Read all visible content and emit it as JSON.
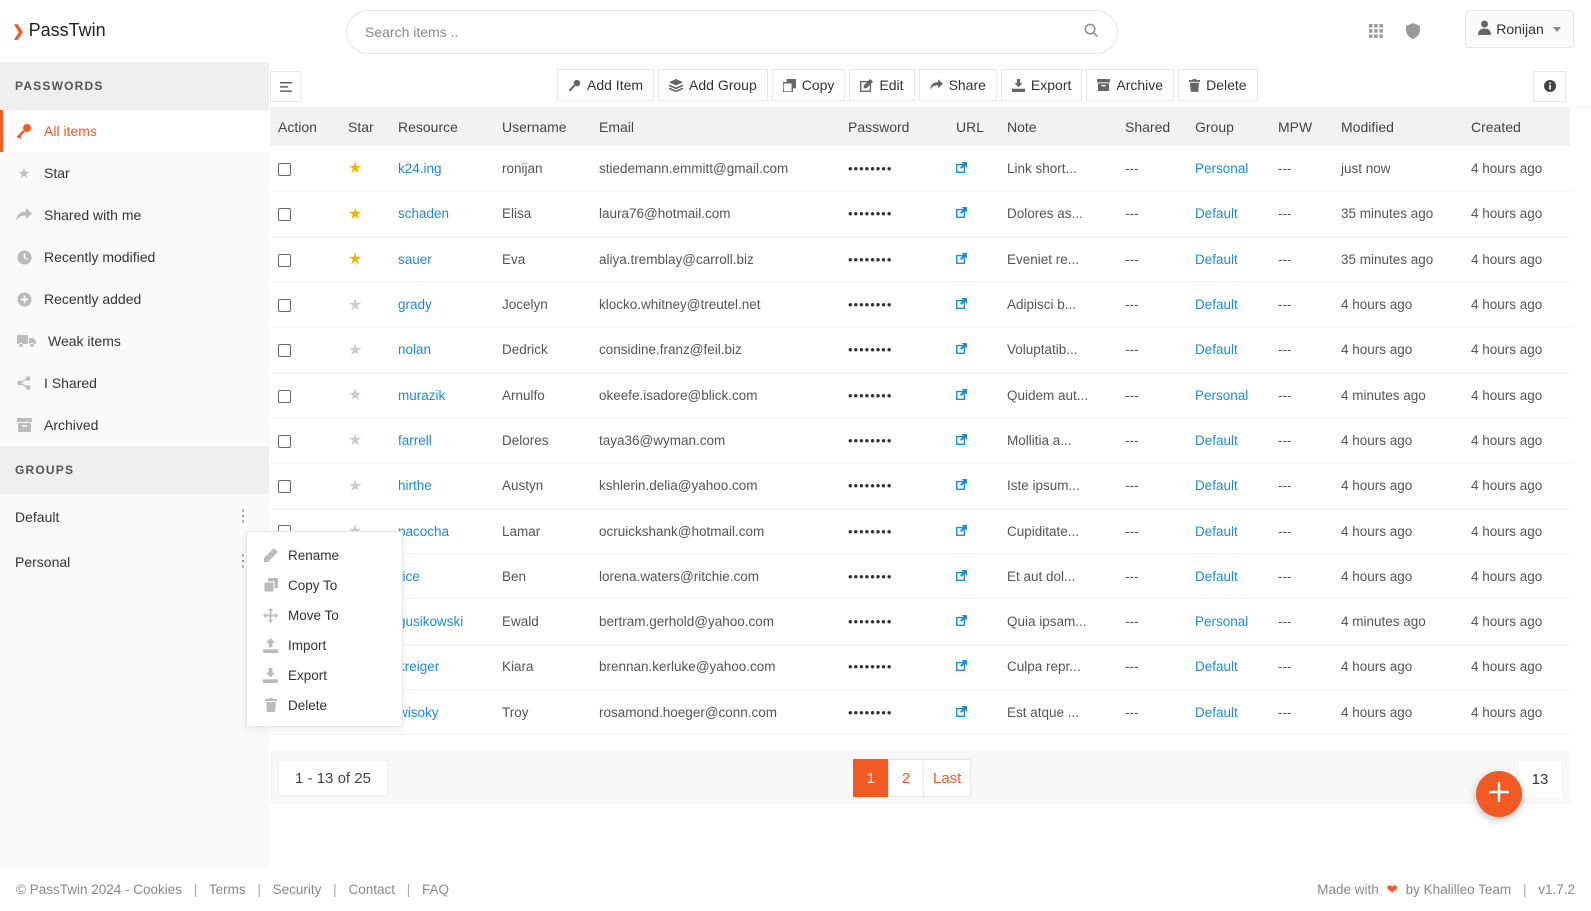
{
  "app": {
    "name": "PassTwin",
    "brand_color": "#f15a22"
  },
  "search": {
    "placeholder": "Search items .."
  },
  "header": {
    "user_name": "Ronijan",
    "icons": [
      "grid-icon",
      "shield-icon",
      "user-avatar-icon"
    ]
  },
  "sidebar": {
    "passwords_heading": "PASSWORDS",
    "items": [
      {
        "label": "All items",
        "icon": "key-icon",
        "active": true
      },
      {
        "label": "Star",
        "icon": "star-icon"
      },
      {
        "label": "Shared with me",
        "icon": "share-icon"
      },
      {
        "label": "Recently modified",
        "icon": "clock-icon"
      },
      {
        "label": "Recently added",
        "icon": "plus-circle-icon"
      },
      {
        "label": "Weak items",
        "icon": "truck-icon"
      },
      {
        "label": "I Shared",
        "icon": "share-alt-icon"
      },
      {
        "label": "Archived",
        "icon": "archive-icon"
      }
    ],
    "groups_heading": "GROUPS",
    "groups": [
      "Default",
      "Personal"
    ]
  },
  "context_menu": {
    "items": [
      {
        "label": "Rename",
        "icon": "pencil-icon"
      },
      {
        "label": "Copy To",
        "icon": "copy-icon"
      },
      {
        "label": "Move To",
        "icon": "move-icon"
      },
      {
        "label": "Import",
        "icon": "upload-icon"
      },
      {
        "label": "Export",
        "icon": "download-icon"
      },
      {
        "label": "Delete",
        "icon": "trash-icon"
      }
    ]
  },
  "toolbar": {
    "add_item": "Add Item",
    "add_group": "Add Group",
    "copy": "Copy",
    "edit": "Edit",
    "share": "Share",
    "export": "Export",
    "archive": "Archive",
    "delete": "Delete"
  },
  "table": {
    "columns": [
      "Action",
      "Star",
      "Resource",
      "Username",
      "Email",
      "Password",
      "URL",
      "Note",
      "Shared",
      "Group",
      "MPW",
      "Modified",
      "Created"
    ],
    "password_mask": "••••••••",
    "rows": [
      {
        "starred": true,
        "resource": "k24.ing",
        "username": "ronijan",
        "email": "stiedemann.emmitt@gmail.com",
        "note": "Link short...",
        "shared": "---",
        "group": "Personal",
        "mpw": "---",
        "modified": "just now",
        "created": "4 hours ago"
      },
      {
        "starred": true,
        "resource": "schaden",
        "username": "Elisa",
        "email": "laura76@hotmail.com",
        "note": "Dolores as...",
        "shared": "---",
        "group": "Default",
        "mpw": "---",
        "modified": "35 minutes ago",
        "created": "4 hours ago"
      },
      {
        "starred": true,
        "resource": "sauer",
        "username": "Eva",
        "email": "aliya.tremblay@carroll.biz",
        "note": "Eveniet re...",
        "shared": "---",
        "group": "Default",
        "mpw": "---",
        "modified": "35 minutes ago",
        "created": "4 hours ago"
      },
      {
        "starred": false,
        "resource": "grady",
        "username": "Jocelyn",
        "email": "klocko.whitney@treutel.net",
        "note": "Adipisci b...",
        "shared": "---",
        "group": "Default",
        "mpw": "---",
        "modified": "4 hours ago",
        "created": "4 hours ago"
      },
      {
        "starred": false,
        "resource": "nolan",
        "username": "Dedrick",
        "email": "considine.franz@feil.biz",
        "note": "Voluptatib...",
        "shared": "---",
        "group": "Default",
        "mpw": "---",
        "modified": "4 hours ago",
        "created": "4 hours ago"
      },
      {
        "starred": false,
        "resource": "murazik",
        "username": "Arnulfo",
        "email": "okeefe.isadore@blick.com",
        "note": "Quidem aut...",
        "shared": "---",
        "group": "Personal",
        "mpw": "---",
        "modified": "4 minutes ago",
        "created": "4 hours ago"
      },
      {
        "starred": false,
        "resource": "farrell",
        "username": "Delores",
        "email": "taya36@wyman.com",
        "note": "Mollitia a...",
        "shared": "---",
        "group": "Default",
        "mpw": "---",
        "modified": "4 hours ago",
        "created": "4 hours ago"
      },
      {
        "starred": false,
        "resource": "hirthe",
        "username": "Austyn",
        "email": "kshlerin.delia@yahoo.com",
        "note": "Iste ipsum...",
        "shared": "---",
        "group": "Default",
        "mpw": "---",
        "modified": "4 hours ago",
        "created": "4 hours ago"
      },
      {
        "starred": false,
        "resource": "pacocha",
        "username": "Lamar",
        "email": "ocruickshank@hotmail.com",
        "note": "Cupiditate...",
        "shared": "---",
        "group": "Default",
        "mpw": "---",
        "modified": "4 hours ago",
        "created": "4 hours ago"
      },
      {
        "starred": false,
        "resource": "rice",
        "username": "Ben",
        "email": "lorena.waters@ritchie.com",
        "note": "Et aut dol...",
        "shared": "---",
        "group": "Default",
        "mpw": "---",
        "modified": "4 hours ago",
        "created": "4 hours ago"
      },
      {
        "starred": false,
        "resource": "gusikowski",
        "username": "Ewald",
        "email": "bertram.gerhold@yahoo.com",
        "note": "Quia ipsam...",
        "shared": "---",
        "group": "Personal",
        "mpw": "---",
        "modified": "4 minutes ago",
        "created": "4 hours ago"
      },
      {
        "starred": false,
        "resource": "kreiger",
        "username": "Kiara",
        "email": "brennan.kerluke@yahoo.com",
        "note": "Culpa repr...",
        "shared": "---",
        "group": "Default",
        "mpw": "---",
        "modified": "4 hours ago",
        "created": "4 hours ago"
      },
      {
        "starred": false,
        "resource": "wisoky",
        "username": "Troy",
        "email": "rosamond.hoeger@conn.com",
        "note": "Est atque ...",
        "shared": "---",
        "group": "Default",
        "mpw": "---",
        "modified": "4 hours ago",
        "created": "4 hours ago"
      }
    ]
  },
  "pagination": {
    "range": "1 - 13 of 25",
    "pages": [
      "1",
      "2",
      "Last"
    ],
    "current": "1",
    "per_page": "13"
  },
  "footer": {
    "copyright": "© PassTwin 2024 - Cookies",
    "links": [
      "Terms",
      "Security",
      "Contact",
      "FAQ"
    ],
    "made_with": "Made with",
    "by": "by Khalilleo Team",
    "version": "v1.7.2"
  }
}
